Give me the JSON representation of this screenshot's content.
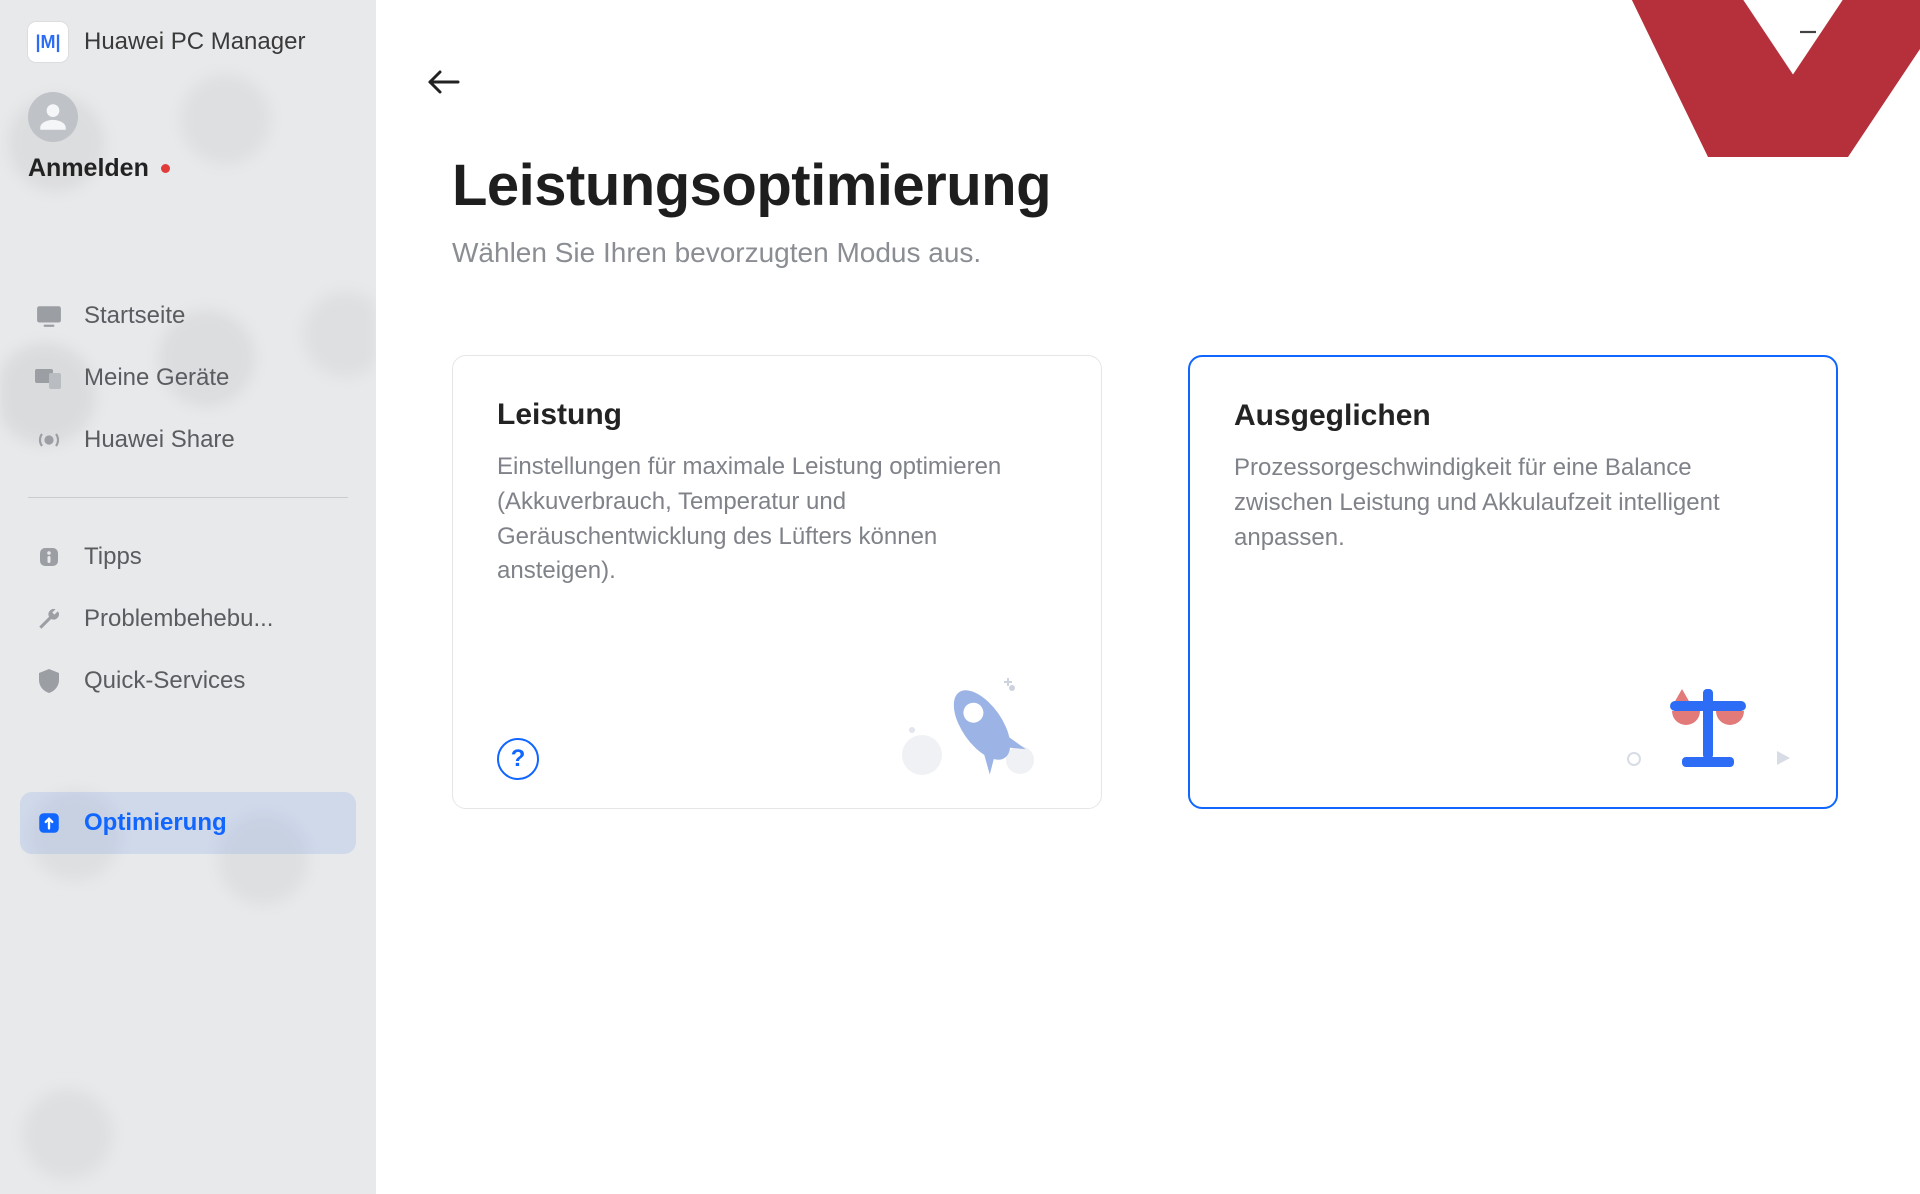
{
  "app": {
    "title": "Huawei PC Manager",
    "logo_text": "|M|"
  },
  "user": {
    "login_label": "Anmelden",
    "has_notification": true
  },
  "sidebar": {
    "group1": [
      {
        "label": "Startseite"
      },
      {
        "label": "Meine Geräte"
      },
      {
        "label": "Huawei Share"
      }
    ],
    "group2": [
      {
        "label": "Tipps"
      },
      {
        "label": "Problembehebu..."
      },
      {
        "label": "Quick-Services"
      }
    ],
    "active": {
      "label": "Optimierung"
    }
  },
  "page": {
    "title": "Leistungsoptimierung",
    "subtitle": "Wählen Sie Ihren bevorzugten Modus aus."
  },
  "modes": {
    "performance": {
      "title": "Leistung",
      "desc": "Einstellungen für maximale Leistung optimieren (Akkuverbrauch, Temperatur und Geräuschentwicklung des Lüfters können ansteigen).",
      "selected": false
    },
    "balanced": {
      "title": "Ausgeglichen",
      "desc": "Prozessorgeschwindigkeit für eine Balance zwischen Leistung und Akkulaufzeit intelligent anpassen.",
      "selected": true
    }
  },
  "help_symbol": "?",
  "colors": {
    "accent": "#1066ff",
    "watermark": "#b5303a"
  }
}
